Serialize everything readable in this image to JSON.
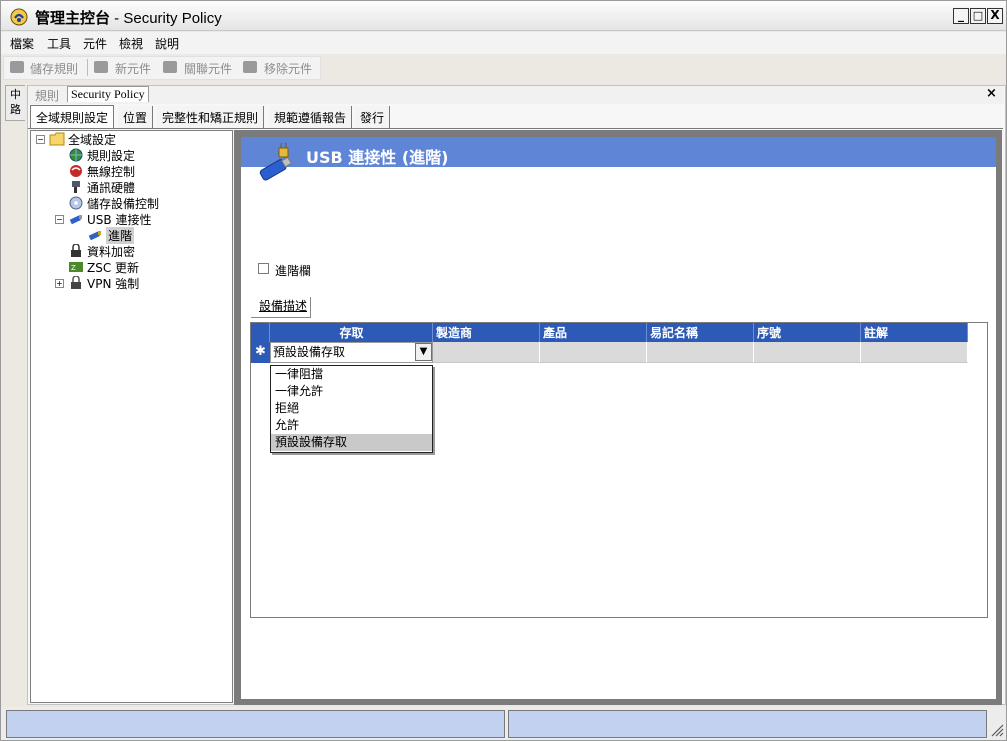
{
  "window": {
    "title_main": "管理主控台",
    "title_sub": " - Security Policy",
    "minimize": "_",
    "maximize": "□",
    "close": "X"
  },
  "menu": [
    "檔案",
    "工具",
    "元件",
    "檢視",
    "說明"
  ],
  "toolbar": {
    "save": "儲存規則",
    "new": "新元件",
    "associate": "關聯元件",
    "remove": "移除元件"
  },
  "side_strip": [
    "中",
    "路"
  ],
  "doc_tabs": {
    "rules": "規則",
    "policy": "Security Policy",
    "close": "×"
  },
  "main_tabs": [
    "全域規則設定",
    "位置",
    "完整性和矯正規則",
    "規範遵循報告",
    "發行"
  ],
  "tree": {
    "root": "全域設定",
    "items": [
      "規則設定",
      "無線控制",
      "通訊硬體",
      "儲存設備控制",
      "USB 連接性",
      "進階",
      "資料加密",
      "ZSC 更新",
      "VPN 強制"
    ]
  },
  "panel": {
    "title": "USB 連接性 (進階)",
    "advanced_checkbox": "進階欄",
    "subtab": "設備描述"
  },
  "grid": {
    "columns": [
      "存取",
      "製造商",
      "產品",
      "易記名稱",
      "序號",
      "註解"
    ],
    "row_marker": "✱",
    "current_value": "預設設備存取",
    "options": [
      "一律阻擋",
      "一律允許",
      "拒絕",
      "允許",
      "預設設備存取"
    ],
    "selected_option": "預設設備存取"
  },
  "colors": {
    "header_blue": "#5f85d7",
    "grid_header": "#2d5ab7",
    "status_fill": "#c3d1f0"
  }
}
